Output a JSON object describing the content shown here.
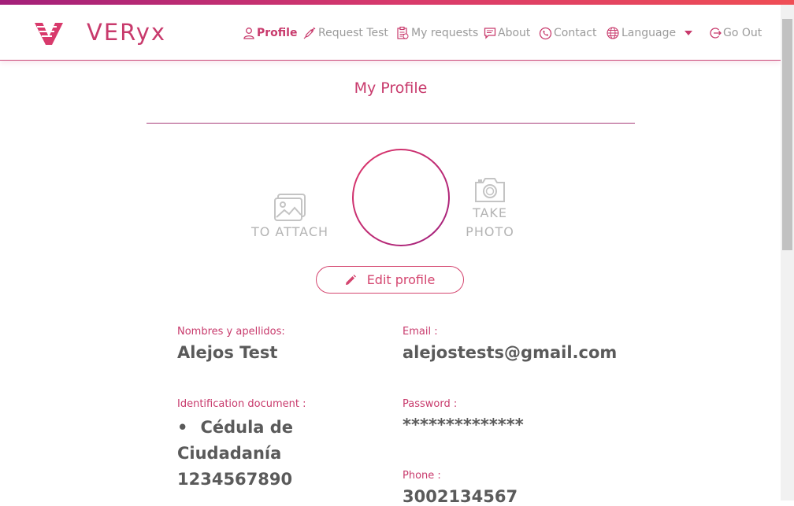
{
  "brand": {
    "name": "VERyx"
  },
  "nav": {
    "profile": "Profile",
    "request_test": "Request Test",
    "my_requests": "My requests",
    "about": "About",
    "contact": "Contact",
    "language": "Language",
    "go_out": "Go Out"
  },
  "page": {
    "title": "My Profile",
    "attach_label": "TO ATTACH",
    "take_photo_line1": "TAKE",
    "take_photo_line2": "PHOTO",
    "edit_label": "Edit profile"
  },
  "profile": {
    "name_label": "Nombres y apellidos:",
    "name_value": "Alejos Test",
    "email_label": "Email :",
    "email_value": "alejostests@gmail.com",
    "id_label": "Identification document :",
    "id_type_line1": "Cédula de",
    "id_type_line2": "Ciudadanía",
    "id_number": "1234567890",
    "password_label": "Password :",
    "password_value": "**************",
    "phone_label": "Phone :",
    "phone_value": "3002134567"
  },
  "colors": {
    "accent": "#c83a6c",
    "muted": "#9b9b9b"
  }
}
